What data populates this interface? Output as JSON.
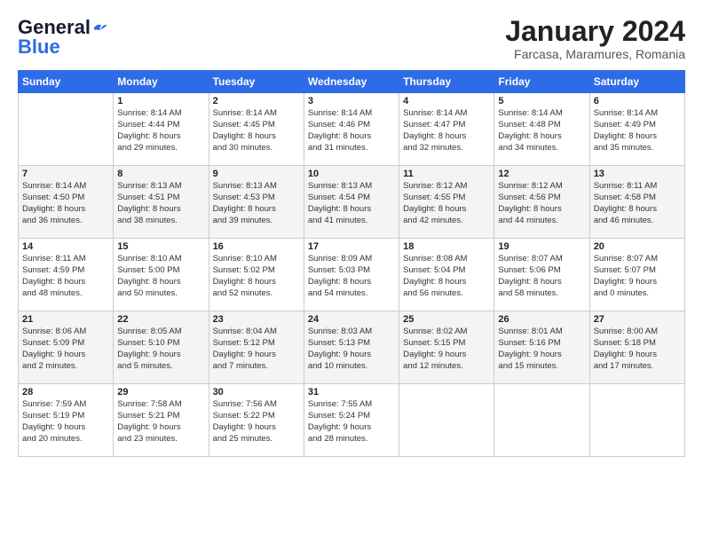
{
  "header": {
    "logo_line1": "General",
    "logo_line2": "Blue",
    "month_title": "January 2024",
    "location": "Farcasa, Maramures, Romania"
  },
  "weekdays": [
    "Sunday",
    "Monday",
    "Tuesday",
    "Wednesday",
    "Thursday",
    "Friday",
    "Saturday"
  ],
  "rows": [
    [
      {
        "num": "",
        "lines": []
      },
      {
        "num": "1",
        "lines": [
          "Sunrise: 8:14 AM",
          "Sunset: 4:44 PM",
          "Daylight: 8 hours",
          "and 29 minutes."
        ]
      },
      {
        "num": "2",
        "lines": [
          "Sunrise: 8:14 AM",
          "Sunset: 4:45 PM",
          "Daylight: 8 hours",
          "and 30 minutes."
        ]
      },
      {
        "num": "3",
        "lines": [
          "Sunrise: 8:14 AM",
          "Sunset: 4:46 PM",
          "Daylight: 8 hours",
          "and 31 minutes."
        ]
      },
      {
        "num": "4",
        "lines": [
          "Sunrise: 8:14 AM",
          "Sunset: 4:47 PM",
          "Daylight: 8 hours",
          "and 32 minutes."
        ]
      },
      {
        "num": "5",
        "lines": [
          "Sunrise: 8:14 AM",
          "Sunset: 4:48 PM",
          "Daylight: 8 hours",
          "and 34 minutes."
        ]
      },
      {
        "num": "6",
        "lines": [
          "Sunrise: 8:14 AM",
          "Sunset: 4:49 PM",
          "Daylight: 8 hours",
          "and 35 minutes."
        ]
      }
    ],
    [
      {
        "num": "7",
        "lines": [
          "Sunrise: 8:14 AM",
          "Sunset: 4:50 PM",
          "Daylight: 8 hours",
          "and 36 minutes."
        ]
      },
      {
        "num": "8",
        "lines": [
          "Sunrise: 8:13 AM",
          "Sunset: 4:51 PM",
          "Daylight: 8 hours",
          "and 38 minutes."
        ]
      },
      {
        "num": "9",
        "lines": [
          "Sunrise: 8:13 AM",
          "Sunset: 4:53 PM",
          "Daylight: 8 hours",
          "and 39 minutes."
        ]
      },
      {
        "num": "10",
        "lines": [
          "Sunrise: 8:13 AM",
          "Sunset: 4:54 PM",
          "Daylight: 8 hours",
          "and 41 minutes."
        ]
      },
      {
        "num": "11",
        "lines": [
          "Sunrise: 8:12 AM",
          "Sunset: 4:55 PM",
          "Daylight: 8 hours",
          "and 42 minutes."
        ]
      },
      {
        "num": "12",
        "lines": [
          "Sunrise: 8:12 AM",
          "Sunset: 4:56 PM",
          "Daylight: 8 hours",
          "and 44 minutes."
        ]
      },
      {
        "num": "13",
        "lines": [
          "Sunrise: 8:11 AM",
          "Sunset: 4:58 PM",
          "Daylight: 8 hours",
          "and 46 minutes."
        ]
      }
    ],
    [
      {
        "num": "14",
        "lines": [
          "Sunrise: 8:11 AM",
          "Sunset: 4:59 PM",
          "Daylight: 8 hours",
          "and 48 minutes."
        ]
      },
      {
        "num": "15",
        "lines": [
          "Sunrise: 8:10 AM",
          "Sunset: 5:00 PM",
          "Daylight: 8 hours",
          "and 50 minutes."
        ]
      },
      {
        "num": "16",
        "lines": [
          "Sunrise: 8:10 AM",
          "Sunset: 5:02 PM",
          "Daylight: 8 hours",
          "and 52 minutes."
        ]
      },
      {
        "num": "17",
        "lines": [
          "Sunrise: 8:09 AM",
          "Sunset: 5:03 PM",
          "Daylight: 8 hours",
          "and 54 minutes."
        ]
      },
      {
        "num": "18",
        "lines": [
          "Sunrise: 8:08 AM",
          "Sunset: 5:04 PM",
          "Daylight: 8 hours",
          "and 56 minutes."
        ]
      },
      {
        "num": "19",
        "lines": [
          "Sunrise: 8:07 AM",
          "Sunset: 5:06 PM",
          "Daylight: 8 hours",
          "and 58 minutes."
        ]
      },
      {
        "num": "20",
        "lines": [
          "Sunrise: 8:07 AM",
          "Sunset: 5:07 PM",
          "Daylight: 9 hours",
          "and 0 minutes."
        ]
      }
    ],
    [
      {
        "num": "21",
        "lines": [
          "Sunrise: 8:06 AM",
          "Sunset: 5:09 PM",
          "Daylight: 9 hours",
          "and 2 minutes."
        ]
      },
      {
        "num": "22",
        "lines": [
          "Sunrise: 8:05 AM",
          "Sunset: 5:10 PM",
          "Daylight: 9 hours",
          "and 5 minutes."
        ]
      },
      {
        "num": "23",
        "lines": [
          "Sunrise: 8:04 AM",
          "Sunset: 5:12 PM",
          "Daylight: 9 hours",
          "and 7 minutes."
        ]
      },
      {
        "num": "24",
        "lines": [
          "Sunrise: 8:03 AM",
          "Sunset: 5:13 PM",
          "Daylight: 9 hours",
          "and 10 minutes."
        ]
      },
      {
        "num": "25",
        "lines": [
          "Sunrise: 8:02 AM",
          "Sunset: 5:15 PM",
          "Daylight: 9 hours",
          "and 12 minutes."
        ]
      },
      {
        "num": "26",
        "lines": [
          "Sunrise: 8:01 AM",
          "Sunset: 5:16 PM",
          "Daylight: 9 hours",
          "and 15 minutes."
        ]
      },
      {
        "num": "27",
        "lines": [
          "Sunrise: 8:00 AM",
          "Sunset: 5:18 PM",
          "Daylight: 9 hours",
          "and 17 minutes."
        ]
      }
    ],
    [
      {
        "num": "28",
        "lines": [
          "Sunrise: 7:59 AM",
          "Sunset: 5:19 PM",
          "Daylight: 9 hours",
          "and 20 minutes."
        ]
      },
      {
        "num": "29",
        "lines": [
          "Sunrise: 7:58 AM",
          "Sunset: 5:21 PM",
          "Daylight: 9 hours",
          "and 23 minutes."
        ]
      },
      {
        "num": "30",
        "lines": [
          "Sunrise: 7:56 AM",
          "Sunset: 5:22 PM",
          "Daylight: 9 hours",
          "and 25 minutes."
        ]
      },
      {
        "num": "31",
        "lines": [
          "Sunrise: 7:55 AM",
          "Sunset: 5:24 PM",
          "Daylight: 9 hours",
          "and 28 minutes."
        ]
      },
      {
        "num": "",
        "lines": []
      },
      {
        "num": "",
        "lines": []
      },
      {
        "num": "",
        "lines": []
      }
    ]
  ]
}
